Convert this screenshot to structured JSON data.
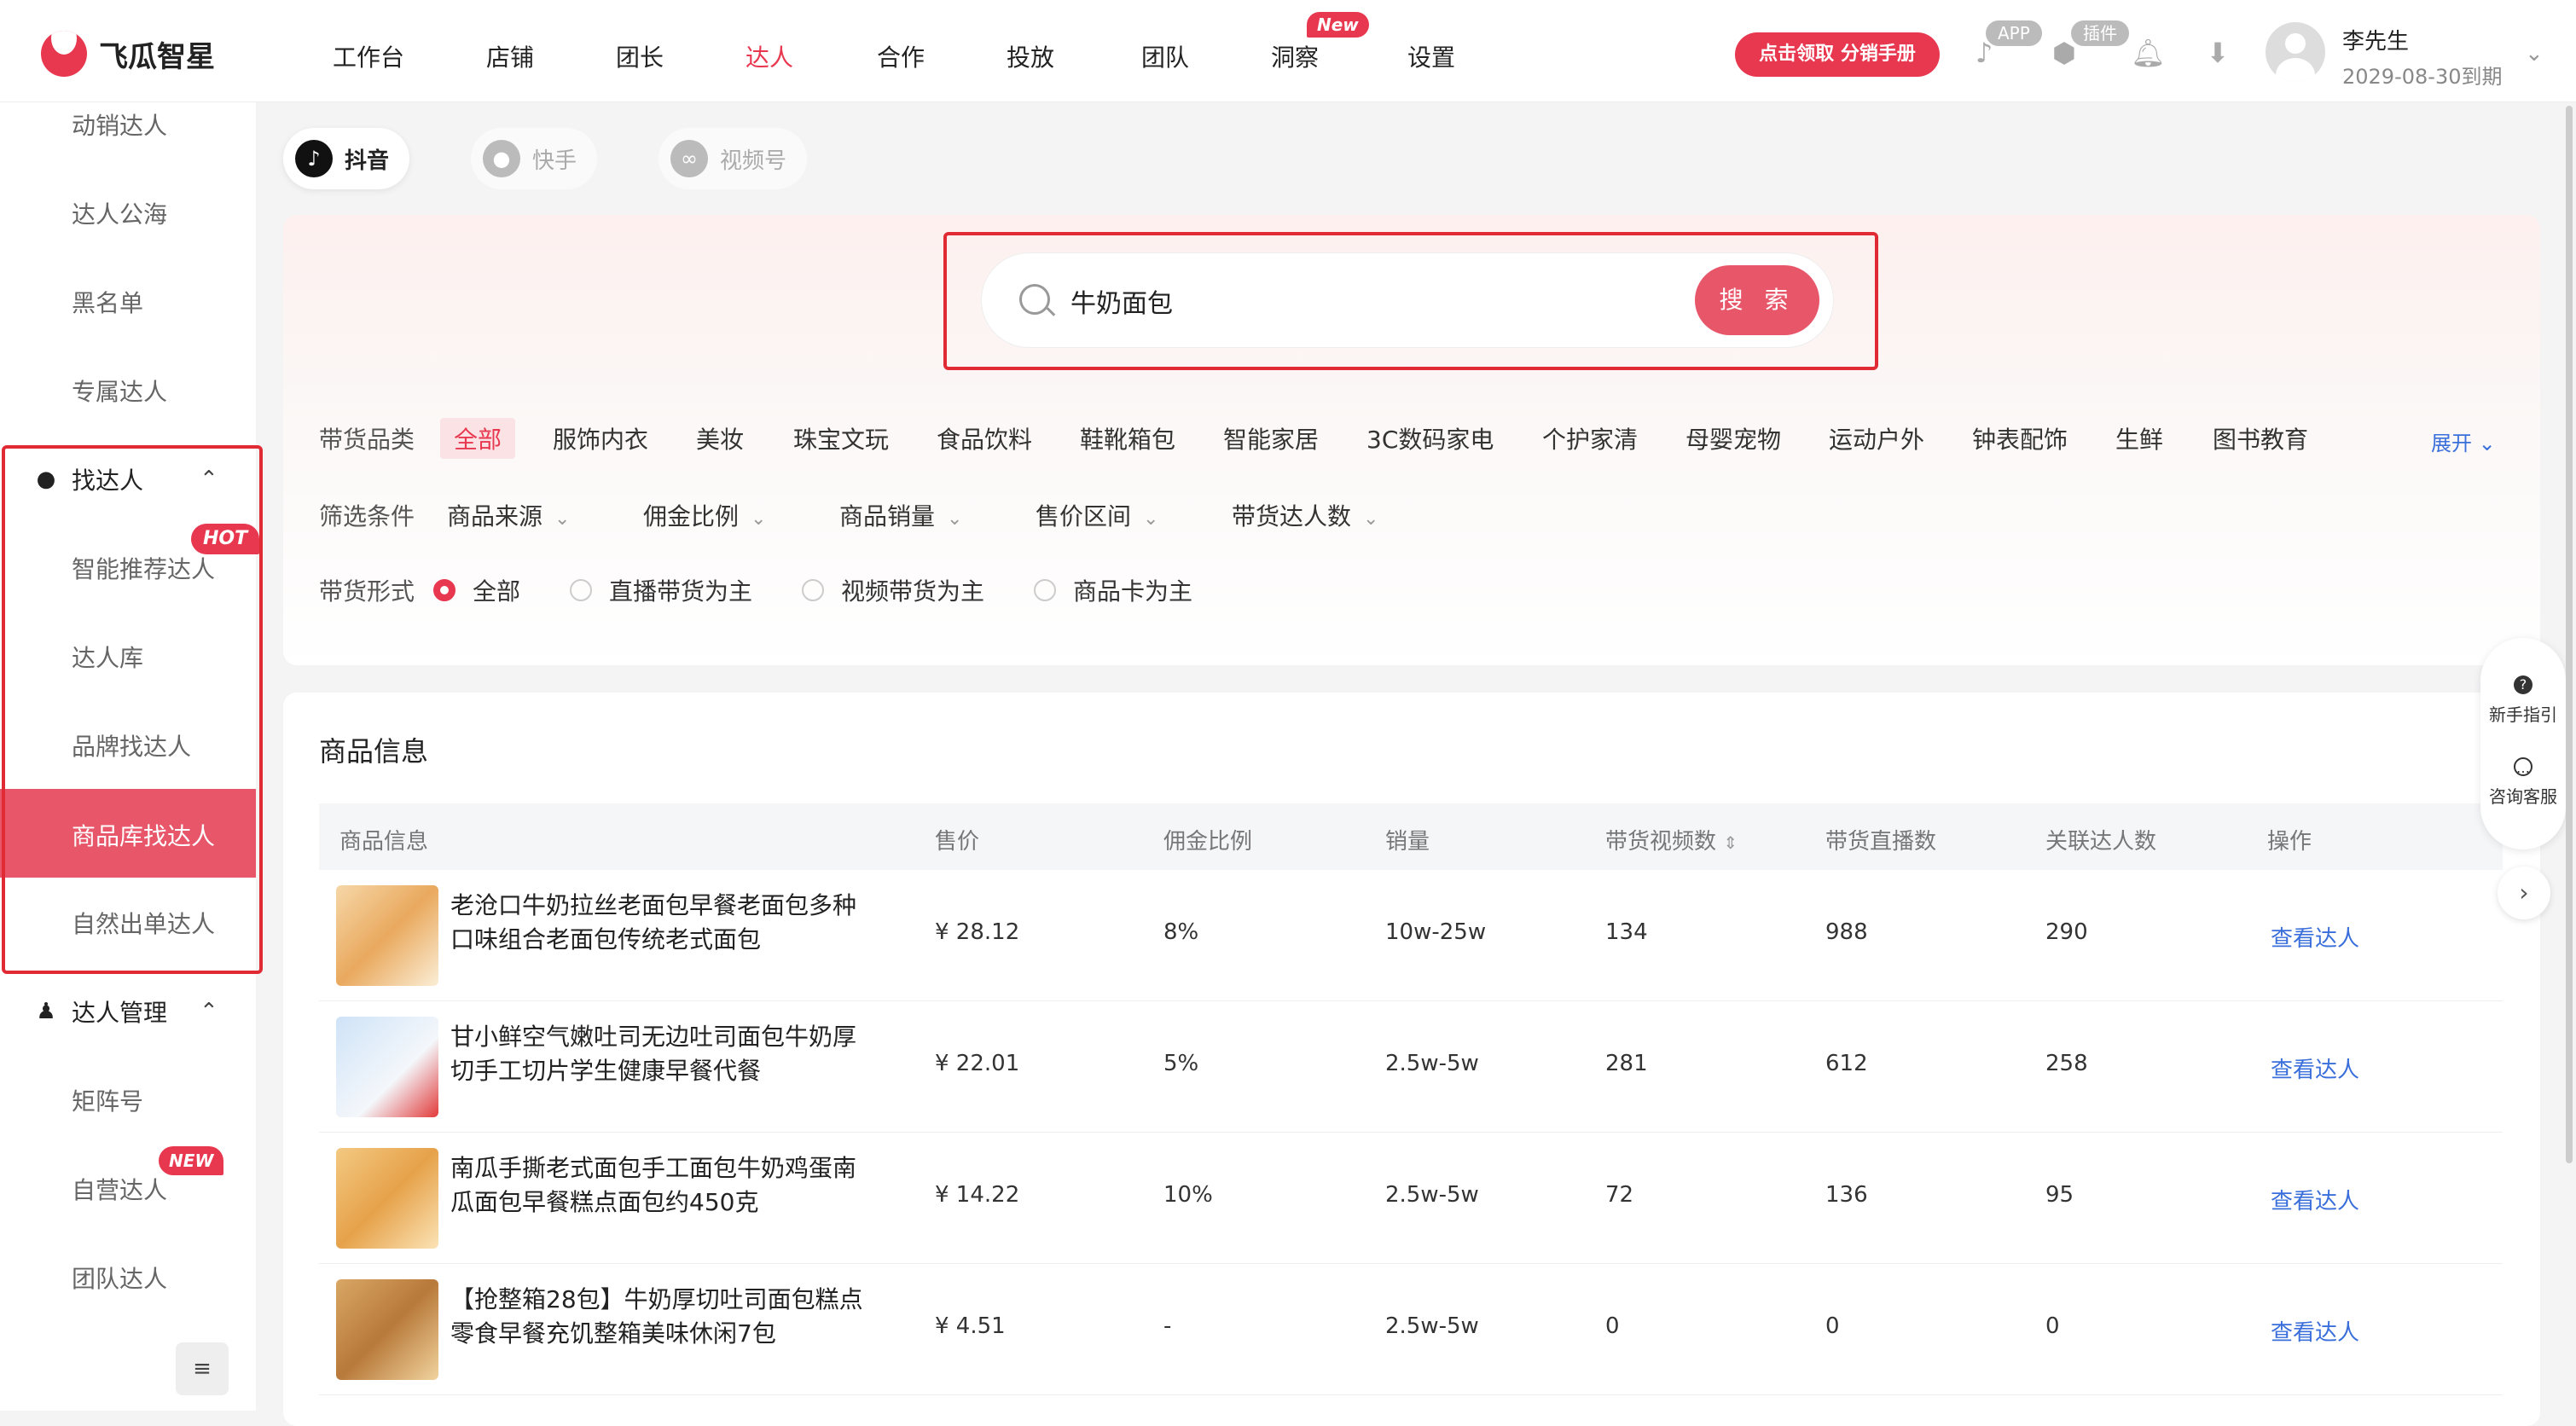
{
  "brand": {
    "name": "飞瓜智星"
  },
  "nav": {
    "items": [
      "工作台",
      "店铺",
      "团长",
      "达人",
      "合作",
      "投放",
      "团队",
      "洞察",
      "设置"
    ],
    "active": "达人",
    "new_badge": "New"
  },
  "header": {
    "promo": "点击领取 分销手册",
    "app_pill": "APP",
    "plugin_pill": "插件",
    "user_name": "李先生",
    "user_expiry": "2029-08-30到期"
  },
  "sidebar": {
    "top_items": [
      "动销达人",
      "达人公海",
      "黑名单",
      "专属达人"
    ],
    "find_section": "找达人",
    "find_items": [
      "智能推荐达人",
      "达人库",
      "品牌找达人",
      "商品库找达人",
      "自然出单达人"
    ],
    "hot_badge": "HOT",
    "manage_section": "达人管理",
    "manage_items": [
      "矩阵号",
      "自营达人",
      "团队达人"
    ],
    "new_badge": "NEW",
    "collapse_icon": "≡"
  },
  "platforms": {
    "items": [
      "抖音",
      "快手",
      "视频号"
    ],
    "active": "抖音"
  },
  "search": {
    "value": "牛奶面包",
    "button": "搜 索"
  },
  "categories": {
    "label": "带货品类",
    "items": [
      "全部",
      "服饰内衣",
      "美妆",
      "珠宝文玩",
      "食品饮料",
      "鞋靴箱包",
      "智能家居",
      "3C数码家电",
      "个护家清",
      "母婴宠物",
      "运动户外",
      "钟表配饰",
      "生鲜",
      "图书教育"
    ],
    "active": "全部",
    "expand": "展开"
  },
  "filters": {
    "label": "筛选条件",
    "items": [
      "商品来源",
      "佣金比例",
      "商品销量",
      "售价区间",
      "带货达人数"
    ]
  },
  "form_filter": {
    "label": "带货形式",
    "options": [
      "全部",
      "直播带货为主",
      "视频带货为主",
      "商品卡为主"
    ],
    "selected": "全部"
  },
  "table": {
    "title": "商品信息",
    "headers": [
      "商品信息",
      "售价",
      "佣金比例",
      "销量",
      "带货视频数",
      "带货直播数",
      "关联达人数",
      "操作"
    ],
    "rows": [
      {
        "name": "老沧口牛奶拉丝老面包早餐老面包多种口味组合老面包传统老式面包",
        "price": "¥ 28.12",
        "commission": "8%",
        "sales": "10w-25w",
        "videos": "134",
        "lives": "988",
        "creators": "290",
        "action": "查看达人"
      },
      {
        "name": "甘小鲜空气嫩吐司无边吐司面包牛奶厚切手工切片学生健康早餐代餐",
        "price": "¥ 22.01",
        "commission": "5%",
        "sales": "2.5w-5w",
        "videos": "281",
        "lives": "612",
        "creators": "258",
        "action": "查看达人"
      },
      {
        "name": "南瓜手撕老式面包手工面包牛奶鸡蛋南瓜面包早餐糕点面包约450克",
        "price": "¥ 14.22",
        "commission": "10%",
        "sales": "2.5w-5w",
        "videos": "72",
        "lives": "136",
        "creators": "95",
        "action": "查看达人"
      },
      {
        "name": "【抢整箱28包】牛奶厚切吐司面包糕点零食早餐充饥整箱美味休闲7包",
        "price": "¥ 4.51",
        "commission": "-",
        "sales": "2.5w-5w",
        "videos": "0",
        "lives": "0",
        "creators": "0",
        "action": "查看达人"
      }
    ]
  },
  "help": {
    "guide": "新手指引",
    "service": "咨询客服"
  }
}
